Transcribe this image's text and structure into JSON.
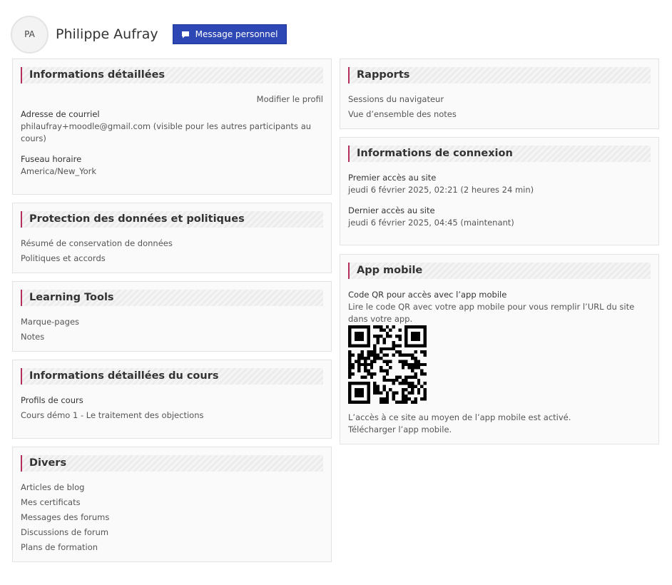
{
  "user": {
    "initials": "PA",
    "name": "Philippe Aufray",
    "message_button": "Message personnel"
  },
  "details": {
    "title": "Informations détaillées",
    "edit_link": "Modifier le profil",
    "email_label": "Adresse de courriel",
    "email_value": "philaufray+moodle@gmail.com (visible pour les autres participants au cours)",
    "timezone_label": "Fuseau horaire",
    "timezone_value": "America/New_York"
  },
  "privacy": {
    "title": "Protection des données et politiques",
    "items": [
      "Résumé de conservation de données",
      "Politiques et accords"
    ]
  },
  "learning_tools": {
    "title": "Learning Tools",
    "items": [
      "Marque-pages",
      "Notes"
    ]
  },
  "course_details": {
    "title": "Informations détaillées du cours",
    "label": "Profils de cours",
    "course": "Cours démo 1 - Le traitement des objections"
  },
  "misc": {
    "title": "Divers",
    "items": [
      "Articles de blog",
      "Mes certificats",
      "Messages des forums",
      "Discussions de forum",
      "Plans de formation"
    ]
  },
  "reports": {
    "title": "Rapports",
    "items": [
      "Sessions du navigateur",
      "Vue d’ensemble des notes"
    ]
  },
  "login": {
    "title": "Informations de connexion",
    "first_label": "Premier accès au site",
    "first_value": "jeudi 6 février 2025, 02:21  (2 heures 24 min)",
    "last_label": "Dernier accès au site",
    "last_value": "jeudi 6 février 2025, 04:45  (maintenant)"
  },
  "mobile": {
    "title": "App mobile",
    "qr_label": "Code QR pour accès avec l’app mobile",
    "qr_desc": "Lire le code QR avec votre app mobile pour vous remplir l’URL du site dans votre app.",
    "enabled_text": "L’accès à ce site au moyen de l’app mobile est activé.",
    "download_link": "Télécharger l’app mobile."
  }
}
